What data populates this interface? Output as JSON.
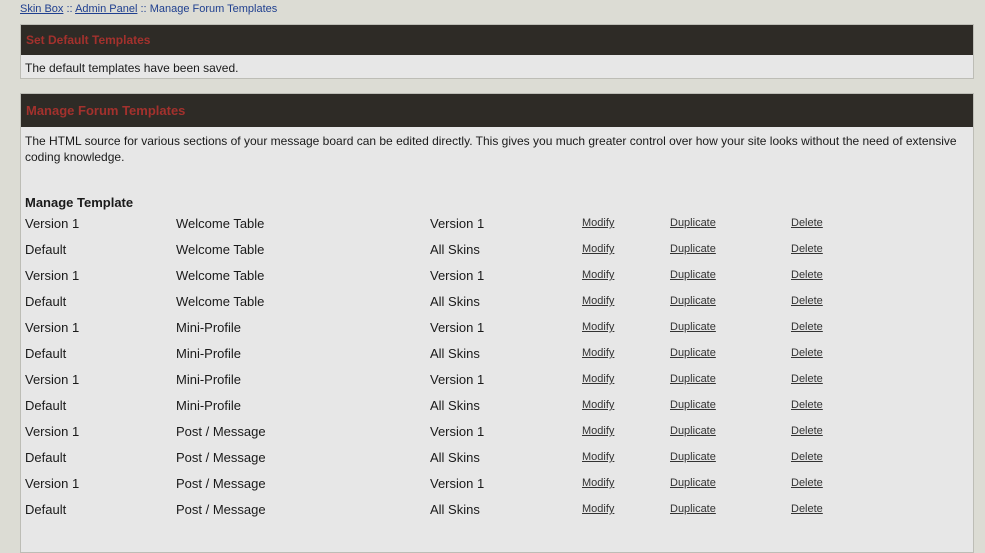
{
  "breadcrumb": {
    "items": [
      "Skin Box",
      "Admin Panel",
      "Manage Forum Templates"
    ],
    "separator": "::"
  },
  "default_panel": {
    "title": "Set Default Templates",
    "message": "The default templates have been saved."
  },
  "manage_panel": {
    "title": "Manage Forum Templates",
    "intro": "The HTML source for various sections of your message board can be edited directly. This gives you much greater control over how your site looks without the need of extensive coding knowledge.",
    "section_title": "Manage Template",
    "actions": {
      "modify": "Modify",
      "duplicate": "Duplicate",
      "delete": "Delete"
    },
    "rows": [
      {
        "version": "Version 1",
        "type": "Welcome Table",
        "skin": "Version 1"
      },
      {
        "version": "Default",
        "type": "Welcome Table",
        "skin": "All Skins"
      },
      {
        "version": "Version 1",
        "type": "Welcome Table",
        "skin": "Version 1"
      },
      {
        "version": "Default",
        "type": "Welcome Table",
        "skin": "All Skins"
      },
      {
        "version": "Version 1",
        "type": "Mini-Profile",
        "skin": "Version 1"
      },
      {
        "version": "Default",
        "type": "Mini-Profile",
        "skin": "All Skins"
      },
      {
        "version": "Version 1",
        "type": "Mini-Profile",
        "skin": "Version 1"
      },
      {
        "version": "Default",
        "type": "Mini-Profile",
        "skin": "All Skins"
      },
      {
        "version": "Version 1",
        "type": "Post / Message",
        "skin": "Version 1"
      },
      {
        "version": "Default",
        "type": "Post / Message",
        "skin": "All Skins"
      },
      {
        "version": "Version 1",
        "type": "Post / Message",
        "skin": "Version 1"
      },
      {
        "version": "Default",
        "type": "Post / Message",
        "skin": "All Skins"
      }
    ]
  },
  "colors": {
    "page_background": "#dcdcd4",
    "panel_background": "#e7e7e7",
    "header_background": "#2e2b26",
    "header_text": "#a3312d",
    "link": "#1f3f8f"
  }
}
